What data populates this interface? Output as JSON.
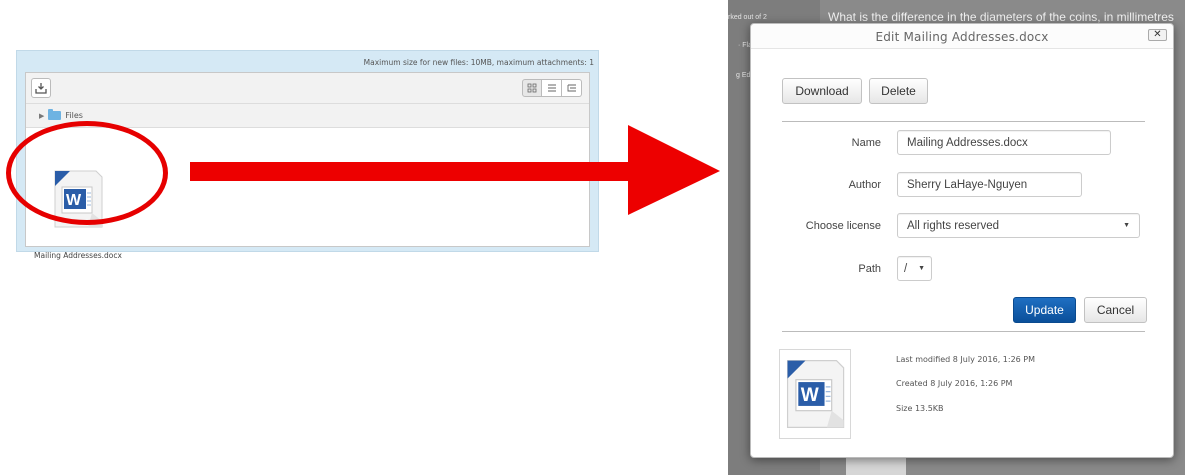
{
  "filemanager": {
    "max_size_text": "Maximum size for new files: 10MB, maximum attachments: 1",
    "path_label": "Files",
    "file": {
      "name": "Mailing Addresses.docx",
      "icon": "word-document-icon"
    }
  },
  "background": {
    "marked_text": "rked out of 2",
    "flag_text": "· Fla",
    "edit_text": "g Ed",
    "question_text": "What is the difference in the diameters of the coins, in millimetres"
  },
  "modal": {
    "title": "Edit Mailing Addresses.docx",
    "close_label": "✕",
    "download_label": "Download",
    "delete_label": "Delete",
    "name_label": "Name",
    "name_value": "Mailing Addresses.docx",
    "author_label": "Author",
    "author_value": "Sherry LaHaye-Nguyen",
    "license_label": "Choose license",
    "license_value": "All rights reserved",
    "path_label": "Path",
    "path_value": "/",
    "update_label": "Update",
    "cancel_label": "Cancel",
    "last_modified": "Last modified  8 July 2016, 1:26 PM",
    "created": "Created  8 July 2016, 1:26 PM",
    "size": "Size  13.5KB"
  },
  "annotation": {
    "color": "#e60000"
  },
  "colors": {
    "update_button": "#1565b8",
    "word_blue": "#2a5da8"
  }
}
